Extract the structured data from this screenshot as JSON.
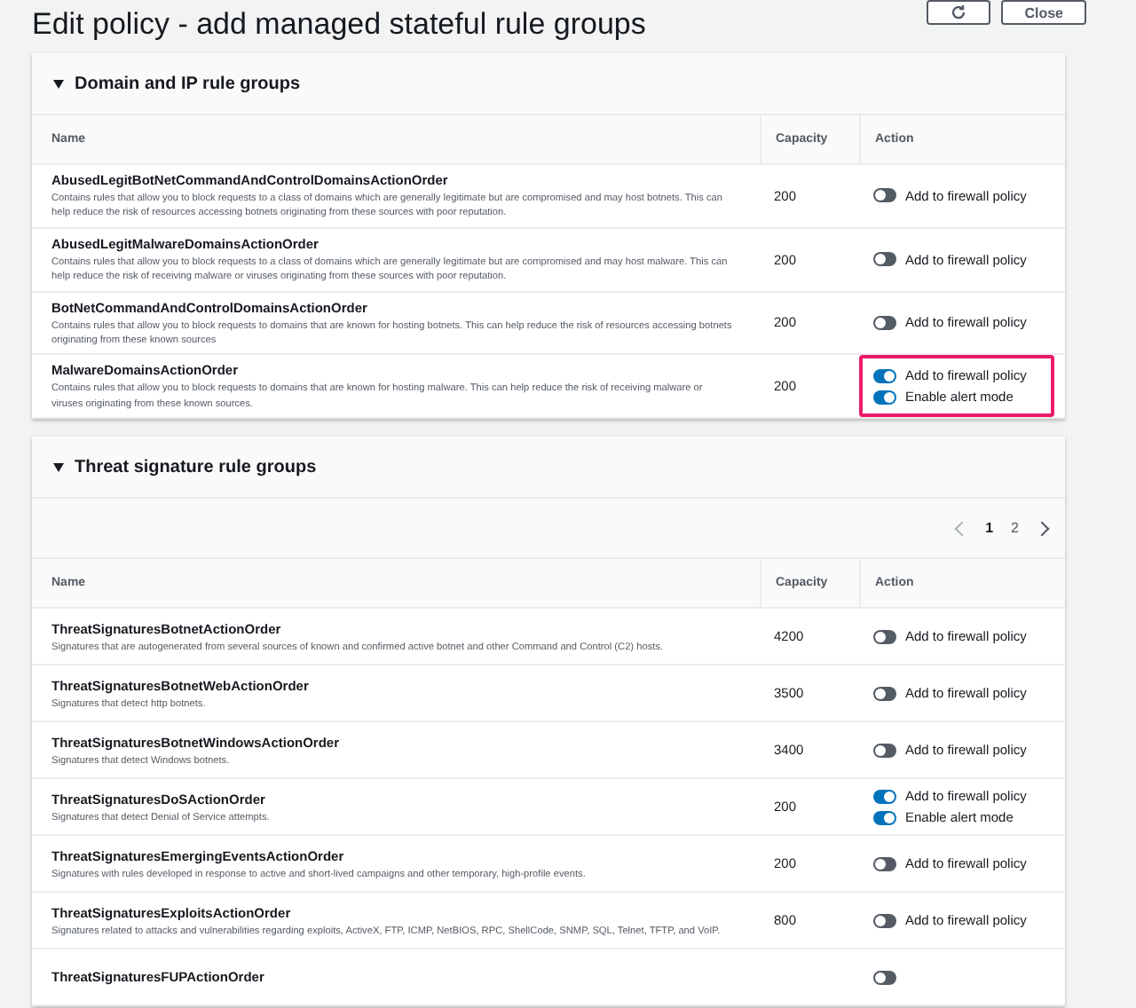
{
  "header": {
    "title": "Edit policy - add managed stateful rule groups",
    "buttons": [
      {
        "kind": "refresh"
      },
      {
        "kind": "text",
        "label": "Close"
      }
    ]
  },
  "sections": [
    {
      "title": "Domain and IP rule groups",
      "expanded": true,
      "columns": [
        "Name",
        "Capacity",
        "Action"
      ],
      "rows": [
        {
          "name": "AbusedLegitBotNetCommandAndControlDomainsActionOrder",
          "description": "Contains rules that allow you to block requests to a class of domains which are generally legitimate but are compromised and may host botnets. This can help reduce the risk of resources accessing botnets originating from these sources with poor reputation.",
          "capacity": "200",
          "highlighted": false,
          "toggles": [
            {
              "label": "Add to firewall policy",
              "on": false
            }
          ]
        },
        {
          "name": "AbusedLegitMalwareDomainsActionOrder",
          "description": "Contains rules that allow you to block requests to a class of domains which are generally legitimate but are compromised and may host malware. This can help reduce the risk of receiving malware or viruses originating from these sources with poor reputation.",
          "capacity": "200",
          "highlighted": false,
          "toggles": [
            {
              "label": "Add to firewall policy",
              "on": false
            }
          ]
        },
        {
          "name": "BotNetCommandAndControlDomainsActionOrder",
          "description": "Contains rules that allow you to block requests to domains that are known for hosting botnets. This can help reduce the risk of resources accessing botnets originating from these known sources",
          "capacity": "200",
          "highlighted": false,
          "toggles": [
            {
              "label": "Add to firewall policy",
              "on": false
            }
          ]
        },
        {
          "name": "MalwareDomainsActionOrder",
          "description": "Contains rules that allow you to block requests to domains that are known for hosting malware. This can help reduce the risk of receiving malware or viruses originating from these known sources.",
          "capacity": "200",
          "highlighted": true,
          "toggles": [
            {
              "label": "Add to firewall policy",
              "on": true
            },
            {
              "label": "Enable alert mode",
              "on": true
            }
          ]
        }
      ]
    },
    {
      "title": "Threat signature rule groups",
      "expanded": true,
      "pagination": {
        "pages": [
          {
            "label": "1",
            "selected": true
          },
          {
            "label": "2",
            "selected": false
          }
        ]
      },
      "columns": [
        "Name",
        "Capacity",
        "Action"
      ],
      "rows": [
        {
          "name": "ThreatSignaturesBotnetActionOrder",
          "description": "Signatures that are autogenerated from several sources of known and confirmed active botnet and other Command and Control (C2) hosts.",
          "capacity": "4200",
          "highlighted": false,
          "toggles": [
            {
              "label": "Add to firewall policy",
              "on": false
            }
          ]
        },
        {
          "name": "ThreatSignaturesBotnetWebActionOrder",
          "description": "Signatures that detect http botnets.",
          "capacity": "3500",
          "highlighted": false,
          "toggles": [
            {
              "label": "Add to firewall policy",
              "on": false
            }
          ]
        },
        {
          "name": "ThreatSignaturesBotnetWindowsActionOrder",
          "description": "Signatures that detect Windows botnets.",
          "capacity": "3400",
          "highlighted": false,
          "toggles": [
            {
              "label": "Add to firewall policy",
              "on": false
            }
          ]
        },
        {
          "name": "ThreatSignaturesDoSActionOrder",
          "description": "Signatures that detect Denial of Service attempts.",
          "capacity": "200",
          "highlighted": false,
          "toggles": [
            {
              "label": "Add to firewall policy",
              "on": true
            },
            {
              "label": "Enable alert mode",
              "on": true
            }
          ]
        },
        {
          "name": "ThreatSignaturesEmergingEventsActionOrder",
          "description": "Signatures with rules developed in response to active and short-lived campaigns and other temporary, high-profile events.",
          "capacity": "200",
          "highlighted": false,
          "toggles": [
            {
              "label": "Add to firewall policy",
              "on": false
            }
          ]
        },
        {
          "name": "ThreatSignaturesExploitsActionOrder",
          "description": "Signatures related to attacks and vulnerabilities regarding exploits, ActiveX, FTP, ICMP, NetBIOS, RPC, ShellCode, SNMP, SQL, Telnet, TFTP, and VoIP.",
          "capacity": "800",
          "highlighted": false,
          "toggles": [
            {
              "label": "Add to firewall policy",
              "on": false
            }
          ]
        },
        {
          "name": "ThreatSignaturesFUPActionOrder",
          "toggles": [
            {
              "on": false
            }
          ]
        }
      ]
    }
  ]
}
